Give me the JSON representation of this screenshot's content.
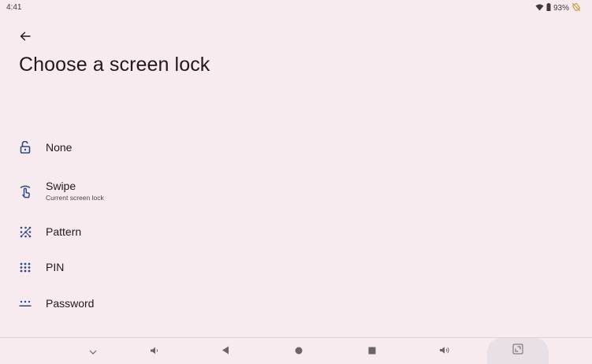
{
  "status_bar": {
    "time": "4:41",
    "battery": "93%"
  },
  "header": {
    "title": "Choose a screen lock"
  },
  "options": [
    {
      "label": "None",
      "icon": "open-lock-icon"
    },
    {
      "label": "Swipe",
      "subtitle": "Current screen lock",
      "icon": "swipe-icon"
    },
    {
      "label": "Pattern",
      "icon": "pattern-icon"
    },
    {
      "label": "PIN",
      "icon": "pin-keypad-icon"
    },
    {
      "label": "Password",
      "icon": "password-icon"
    }
  ],
  "colors": {
    "background": "#f7ebf0",
    "accent_icon": "#2e4a86",
    "text": "#1f1a1d"
  }
}
